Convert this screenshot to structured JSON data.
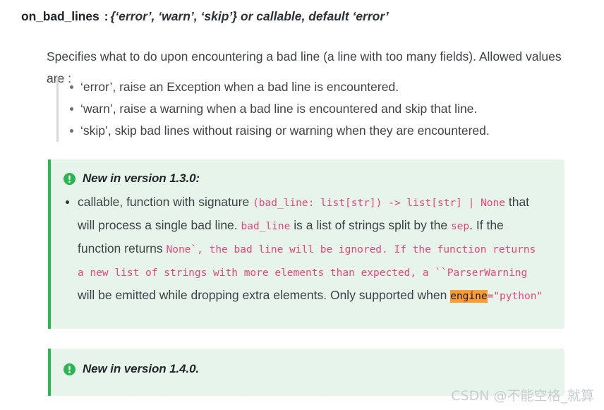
{
  "signature": {
    "name": "on_bad_lines",
    "colon": ":",
    "type": "{‘error’, ‘warn’, ‘skip’} or callable, default ‘error’"
  },
  "description": "Specifies what to do upon encountering a bad line (a line with too many fields). Allowed values are :",
  "allowed_values": [
    "‘error’, raise an Exception when a bad line is encountered.",
    "‘warn’, raise a warning when a bad line is encountered and skip that line.",
    "‘skip’, skip bad lines without raising or warning when they are encountered."
  ],
  "admonitions": [
    {
      "icon": "alert-circle-icon",
      "icon_color": "#2eb355",
      "title": "New in version 1.3.0:",
      "border_color": "#2eb355",
      "background": "#e7f4ea",
      "body": {
        "seg1": "callable, function with signature ",
        "code1": "(bad_line: list[str]) -> list[str] | None",
        "seg2": " that will process a single bad line. ",
        "code2": "bad_line",
        "seg3": " is a list of strings split by the ",
        "code3": "sep",
        "seg4": ". If the function returns ",
        "code4": "None`, the bad line will be ignored. If the function returns a new list of strings with more elements than expected, a ``ParserWarning",
        "seg5": " will be emitted while dropping extra elements. Only supported when ",
        "code_highlight": "engine",
        "code5": "=\"python\""
      }
    },
    {
      "icon": "alert-circle-icon",
      "icon_color": "#2eb355",
      "title": "New in version 1.4.0.",
      "border_color": "#2eb355",
      "background": "#e7f4ea"
    }
  ],
  "watermark": "CSDN @不能空格_就算"
}
